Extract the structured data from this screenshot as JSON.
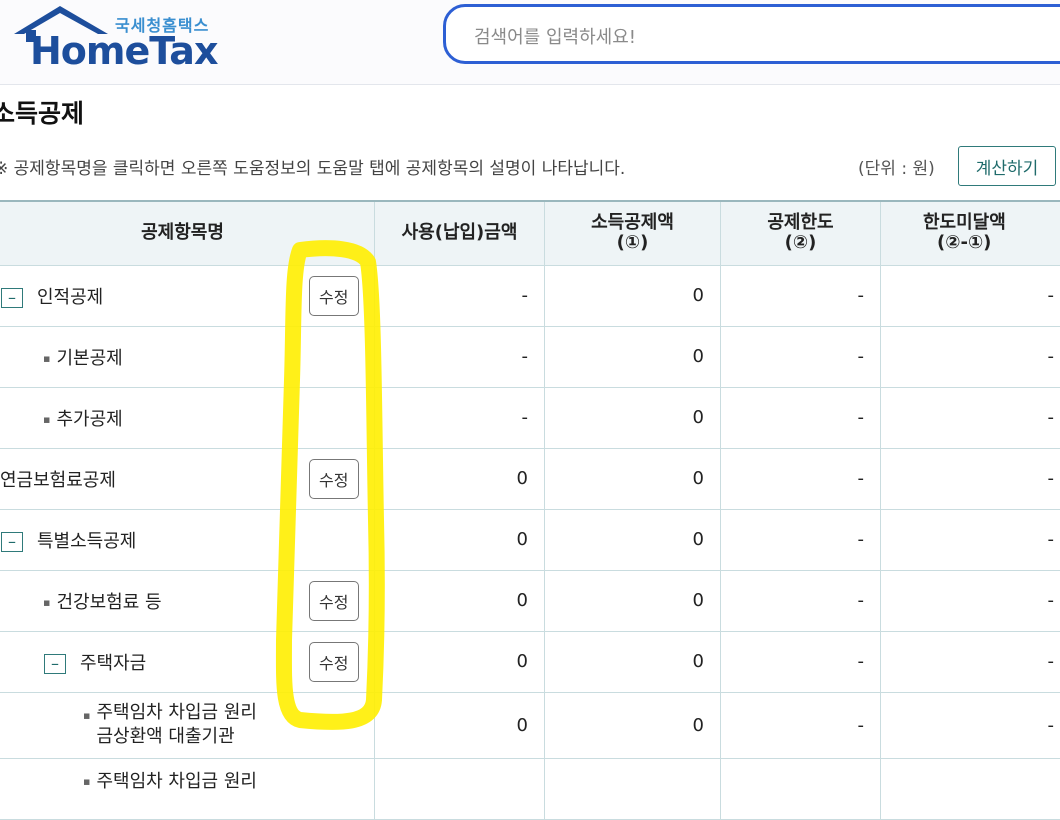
{
  "header": {
    "logo_sub": "국세청홈택스",
    "logo_main": "HomeTax",
    "search_placeholder": "검색어를 입력하세요!"
  },
  "page": {
    "title": "소득공제",
    "notice": "※ 공제항목명을 클릭하면 오른쪽 도움정보의 도움말 탭에 공제항목의 설명이 나타납니다.",
    "unit": "(단위 : 원)",
    "calc_button": "계산하기"
  },
  "table": {
    "headers": {
      "name": "공제항목명",
      "used": "사용(납입)금액",
      "deduct_line1": "소득공제액",
      "deduct_line2": "(①)",
      "limit_line1": "공제한도",
      "limit_line2": "(②)",
      "remain_line1": "한도미달액",
      "remain_line2": "(②-①)"
    },
    "edit_label": "수정",
    "toggle_symbol": "–",
    "bullet_symbol": "▪",
    "rows": [
      {
        "name": "인적공제",
        "used": "-",
        "deduct": "0",
        "limit": "-",
        "remain": "-"
      },
      {
        "name": "기본공제",
        "used": "-",
        "deduct": "0",
        "limit": "-",
        "remain": "-"
      },
      {
        "name": "추가공제",
        "used": "-",
        "deduct": "0",
        "limit": "-",
        "remain": "-"
      },
      {
        "name": "연금보험료공제",
        "used": "0",
        "deduct": "0",
        "limit": "-",
        "remain": "-"
      },
      {
        "name": "특별소득공제",
        "used": "0",
        "deduct": "0",
        "limit": "-",
        "remain": "-"
      },
      {
        "name": "건강보험료 등",
        "used": "0",
        "deduct": "0",
        "limit": "-",
        "remain": "-"
      },
      {
        "name": "주택자금",
        "used": "0",
        "deduct": "0",
        "limit": "-",
        "remain": "-"
      },
      {
        "name_line1": "주택임차 차입금 원리",
        "name_line2": "금상환액 대출기관",
        "used": "0",
        "deduct": "0",
        "limit": "-",
        "remain": "-"
      },
      {
        "name_line1": "주택임차 차입금 원리"
      }
    ]
  },
  "colors": {
    "accent_teal": "#2f7a7a",
    "search_border": "#2d5fd4",
    "header_bg": "#eef4f6",
    "highlight": "#ffee00"
  }
}
